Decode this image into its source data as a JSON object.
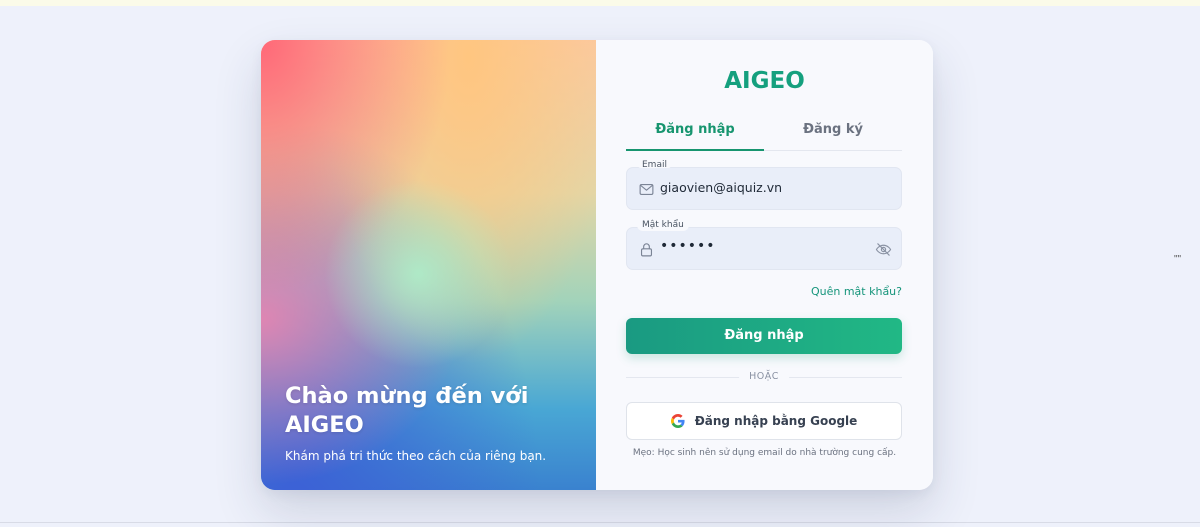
{
  "brand": "AIGEO",
  "hero": {
    "title": "Chào mừng đến với AIGEO",
    "subtitle": "Khám phá tri thức theo cách của riêng bạn."
  },
  "tabs": [
    {
      "label": "Đăng nhập",
      "active": true
    },
    {
      "label": "Đăng ký",
      "active": false
    }
  ],
  "email": {
    "label": "Email",
    "value": "giaovien@aiquiz.vn",
    "icon": "mail-icon"
  },
  "password": {
    "label": "Mật khẩu",
    "value": "••••••",
    "icon": "lock-icon",
    "toggle_icon": "eye-off-icon"
  },
  "forgot_label": "Quên mật khẩu?",
  "login_button": "Đăng nhập",
  "divider_text": "HOẶC",
  "google_button": "Đăng nhập bằng Google",
  "tip": "Mẹo: Học sinh nên sử dụng email do nhà trường cung cấp.",
  "corner_mark": "\"\"",
  "colors": {
    "accent": "#17956f",
    "button_start": "#1a9a82",
    "button_end": "#21b885",
    "page_bg": "#eef1fb",
    "field_bg": "#e9eef9"
  }
}
